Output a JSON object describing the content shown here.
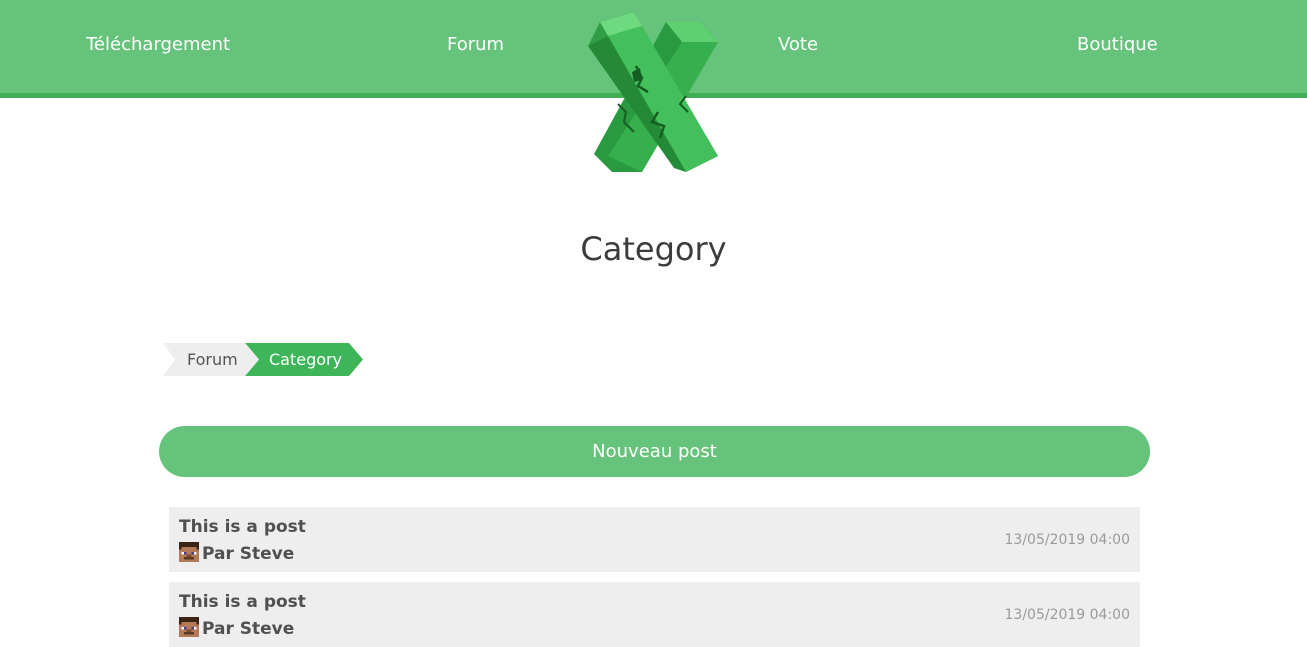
{
  "nav": {
    "items": [
      {
        "label": "Téléchargement"
      },
      {
        "label": "Forum"
      },
      {
        "label": "Vote"
      },
      {
        "label": "Boutique"
      }
    ]
  },
  "page": {
    "title": "Category"
  },
  "breadcrumb": {
    "items": [
      {
        "label": "Forum"
      },
      {
        "label": "Category"
      }
    ]
  },
  "actions": {
    "new_post_label": "Nouveau post"
  },
  "posts": [
    {
      "title": "This is a post",
      "author": "Par Steve",
      "date": "13/05/2019 04:00"
    },
    {
      "title": "This is a post",
      "author": "Par Steve",
      "date": "13/05/2019 04:00"
    }
  ],
  "colors": {
    "header_bg": "#66c37b",
    "header_border": "#3fae55",
    "accent": "#3fb55a",
    "post_bg": "#eeeeee"
  }
}
